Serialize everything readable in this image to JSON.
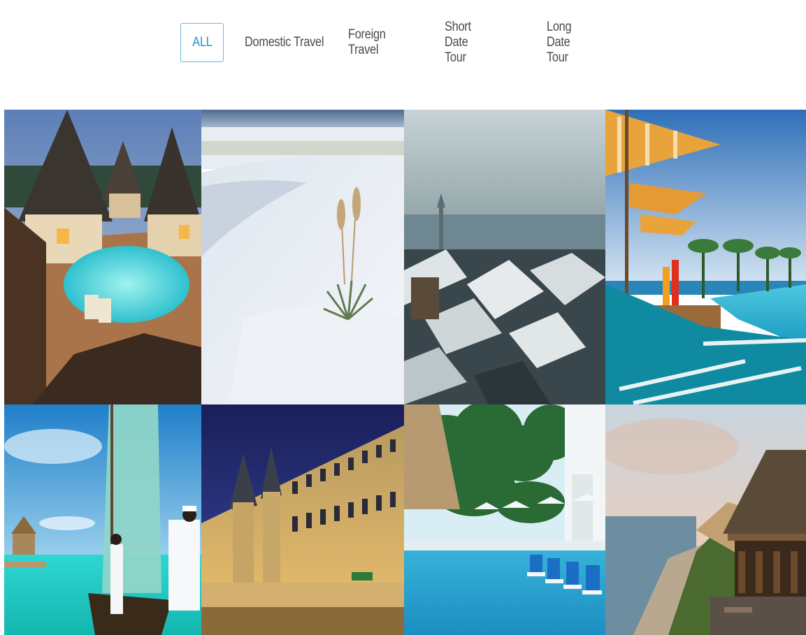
{
  "filters": {
    "items": [
      {
        "label": "ALL",
        "active": true
      },
      {
        "label": "Domestic Travel",
        "active": false
      },
      {
        "label": "Foreign Travel",
        "active": false
      },
      {
        "label": "Short Date Tour",
        "active": false
      },
      {
        "label": "Long Date Tour",
        "active": false
      }
    ],
    "colors": {
      "active_border": "#6fb8e0",
      "active_text": "#1e8fd0",
      "text": "#4a4a4a"
    }
  },
  "gallery": {
    "photos": [
      {
        "subject": "overwater villas with thatched cone roofs and pool at dusk"
      },
      {
        "subject": "white sand dunes with desert yucca plant"
      },
      {
        "subject": "snowy rooftops of old european city"
      },
      {
        "subject": "striped umbrellas and turquoise loungers by infinity pool"
      },
      {
        "subject": "sailboat on turquoise lagoon with men in white"
      },
      {
        "subject": "illuminated gothic palace along river at night"
      },
      {
        "subject": "resort pool with palm trees and blue loungers"
      },
      {
        "subject": "thatched clifftop restaurant overlooking ocean"
      }
    ]
  }
}
